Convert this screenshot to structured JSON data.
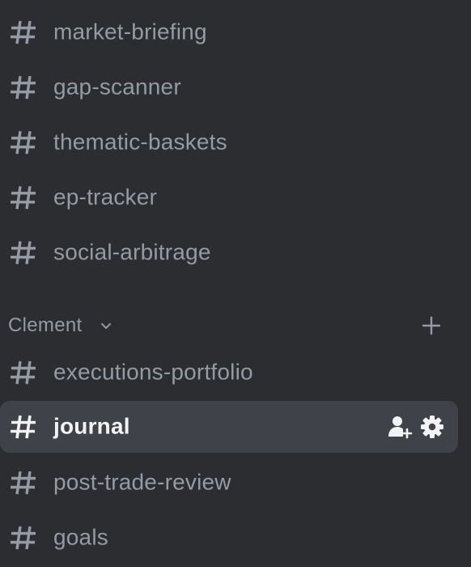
{
  "channels_top": [
    {
      "name": "market-briefing",
      "icon": "hash-icon"
    },
    {
      "name": "gap-scanner",
      "icon": "hash-icon"
    },
    {
      "name": "thematic-baskets",
      "icon": "hash-icon"
    },
    {
      "name": "ep-tracker",
      "icon": "hash-icon"
    },
    {
      "name": "social-arbitrage",
      "icon": "hash-icon"
    }
  ],
  "category": {
    "name": "Clement",
    "chevron_icon": "chevron-down-icon",
    "add_icon": "plus-icon"
  },
  "channels_category": [
    {
      "name": "executions-portfolio",
      "icon": "hash-icon"
    },
    {
      "name": "journal",
      "icon": "hash-icon",
      "active": true,
      "action_icons": [
        "invite-member-icon",
        "gear-icon"
      ]
    },
    {
      "name": "post-trade-review",
      "icon": "hash-icon"
    },
    {
      "name": "goals",
      "icon": "hash-icon"
    }
  ],
  "colors": {
    "background": "#2b2d31",
    "active_background": "#404249",
    "muted_text": "#949ba4",
    "active_text": "#f2f3f5"
  }
}
